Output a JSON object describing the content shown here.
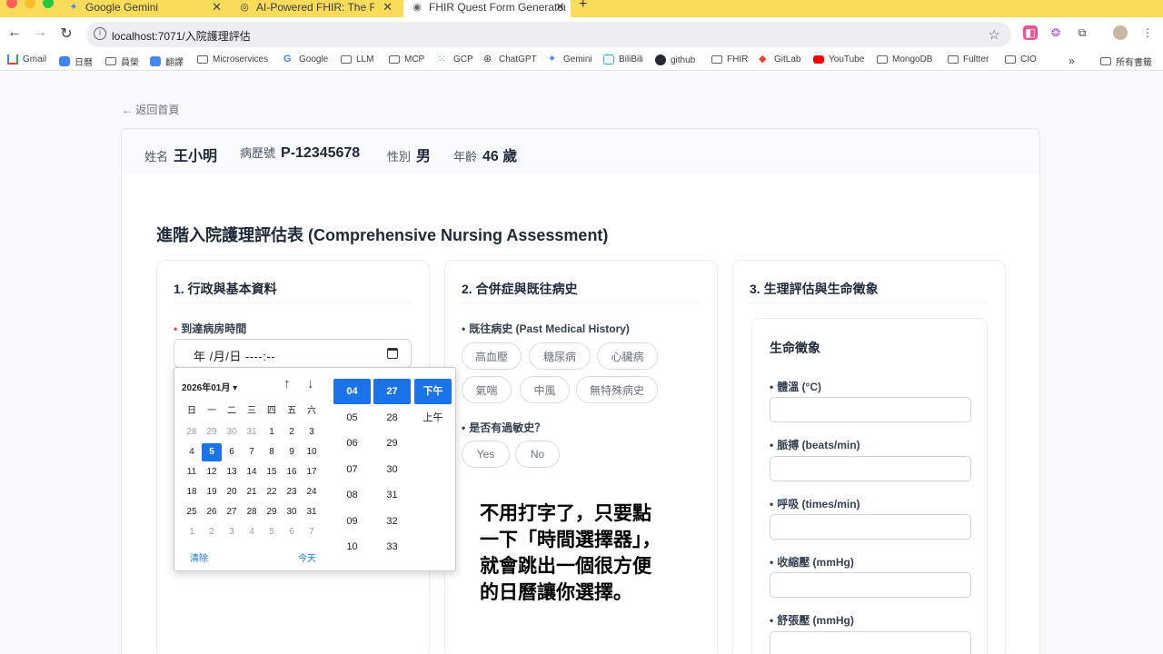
{
  "browser": {
    "tabs": [
      {
        "title": "Google Gemini",
        "icon": "gemini-icon"
      },
      {
        "title": "AI-Powered FHIR: The Future",
        "icon": "openai-icon"
      },
      {
        "title": "FHIR Quest Form Generator",
        "icon": "globe-icon"
      }
    ],
    "new_tab": "+",
    "url": "localhost:7071/入院護理評估",
    "bookmarks": [
      "Gmail",
      "日曆",
      "員榮",
      "翻譯",
      "Microservices",
      "Google",
      "LLM",
      "MCP",
      "GCP",
      "ChatGPT",
      "Gemini",
      "BiliBili",
      "github",
      "FHIR",
      "GitLab",
      "YouTube",
      "MongoDB",
      "Fultter",
      "CIO"
    ],
    "bookmarks_more": "»",
    "all_bookmarks": "所有書籤"
  },
  "page": {
    "back_link": "← 返回首頁",
    "patient": {
      "name_label": "姓名",
      "name": "王小明",
      "mrn_label": "病歷號",
      "mrn": "P-12345678",
      "gender_label": "性別",
      "gender": "男",
      "age_label": "年齡",
      "age": "46 歲"
    },
    "form_title": "進階入院護理評估表 (Comprehensive Nursing Assessment)",
    "sections": {
      "admin": {
        "title": "1. 行政與基本資料",
        "arrival_label": "到達病房時間",
        "arrival_value": "年 /月/日 ----:--"
      },
      "history": {
        "title": "2. 合併症與既往病史",
        "pmh_label": "既往病史 (Past Medical History)",
        "pmh_options": [
          "高血壓",
          "糖尿病",
          "心臟病",
          "氣喘",
          "中風",
          "無特殊病史"
        ],
        "allergy_label": "是否有過敏史？",
        "allergy_options": [
          "Yes",
          "No"
        ]
      },
      "vitals": {
        "title": "3. 生理評估與生命徵象",
        "box_title": "生命徵象",
        "fields": [
          "體溫 (°C)",
          "脈搏 (beats/min)",
          "呼吸 (times/min)",
          "收縮壓 (mmHg)",
          "舒張壓 (mmHg)"
        ]
      }
    }
  },
  "datepicker": {
    "month": "2026年01月 ▾",
    "up": "↑",
    "down": "↓",
    "weekdays": [
      "日",
      "一",
      "二",
      "三",
      "四",
      "五",
      "六"
    ],
    "weeks": [
      [
        "28",
        "29",
        "30",
        "31",
        "1",
        "2",
        "3"
      ],
      [
        "4",
        "5",
        "6",
        "7",
        "8",
        "9",
        "10"
      ],
      [
        "11",
        "12",
        "13",
        "14",
        "15",
        "16",
        "17"
      ],
      [
        "18",
        "19",
        "20",
        "21",
        "22",
        "23",
        "24"
      ],
      [
        "25",
        "26",
        "27",
        "28",
        "29",
        "30",
        "31"
      ],
      [
        "1",
        "2",
        "3",
        "4",
        "5",
        "6",
        "7"
      ]
    ],
    "selected_day": "5",
    "clear": "清除",
    "today": "今天",
    "hours": [
      "04",
      "05",
      "06",
      "07",
      "08",
      "09",
      "10"
    ],
    "minutes": [
      "27",
      "28",
      "29",
      "30",
      "31",
      "32",
      "33"
    ],
    "ampm": [
      "下午",
      "上午"
    ]
  },
  "caption": {
    "lines": [
      "不用打字了，只要點",
      "一下「時間選擇器」，",
      "就會跳出一個很方便",
      "的日曆讓你選擇。"
    ]
  },
  "colors": {
    "tabstrip": "#f8dc5a",
    "accent": "#1a73e8",
    "required": "#ef4444"
  }
}
